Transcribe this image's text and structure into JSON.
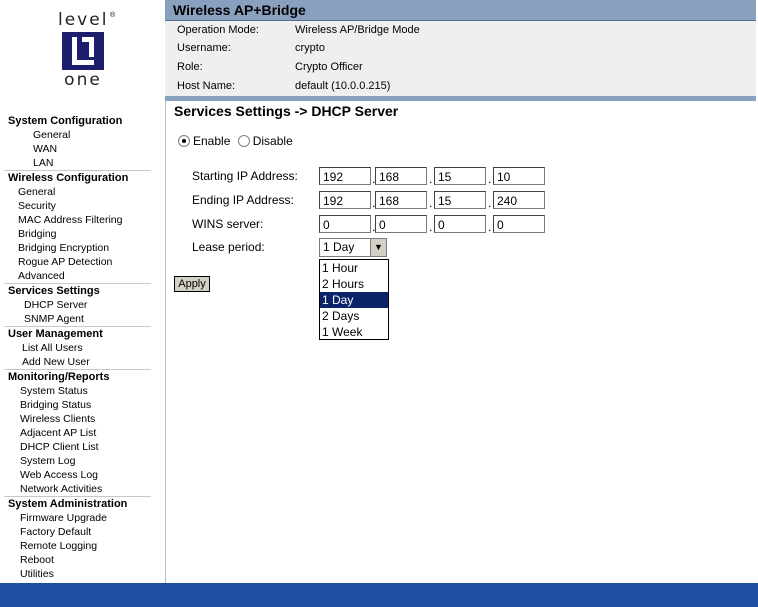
{
  "logo": {
    "top": "level",
    "bottom": "one",
    "reg": "®"
  },
  "header": {
    "title": "Wireless AP+Bridge",
    "info": [
      {
        "label": "Operation Mode:",
        "value": "Wireless AP/Bridge Mode"
      },
      {
        "label": "Username:",
        "value": "crypto"
      },
      {
        "label": "Role:",
        "value": "Crypto Officer"
      },
      {
        "label": "Host Name:",
        "value": "default (10.0.0.215)"
      }
    ]
  },
  "sidebar": {
    "sections": [
      {
        "title": "System Configuration",
        "items": [
          "General",
          "WAN",
          "LAN"
        ]
      },
      {
        "title": "Wireless Configuration",
        "items": [
          "General",
          "Security",
          "MAC Address Filtering",
          "Bridging",
          "Bridging Encryption",
          "Rogue AP Detection",
          "Advanced"
        ]
      },
      {
        "title": "Services Settings",
        "items": [
          "DHCP Server",
          "SNMP Agent"
        ]
      },
      {
        "title": "User Management",
        "items": [
          "List All Users",
          "Add New User"
        ]
      },
      {
        "title": "Monitoring/Reports",
        "items": [
          "System Status",
          "Bridging Status",
          "Wireless Clients",
          "Adjacent AP List",
          "DHCP Client List",
          "System Log",
          "Web Access Log",
          "Network Activities"
        ]
      },
      {
        "title": "System Administration",
        "items": [
          "Firmware Upgrade",
          "Factory Default",
          "Remote Logging",
          "Reboot",
          "Utilities"
        ]
      }
    ]
  },
  "main": {
    "title": "Services Settings -> DHCP Server",
    "enable_label": "Enable",
    "disable_label": "Disable",
    "starting_ip": {
      "label": "Starting IP Address:",
      "octets": [
        "192",
        "168",
        "15",
        "10"
      ]
    },
    "ending_ip": {
      "label": "Ending IP Address:",
      "octets": [
        "192",
        "168",
        "15",
        "240"
      ]
    },
    "wins": {
      "label": "WINS server:",
      "octets": [
        "0",
        "0",
        "0",
        "0"
      ]
    },
    "lease": {
      "label": "Lease period:",
      "selected": "1 Day",
      "options": [
        "1 Hour",
        "2 Hours",
        "1 Day",
        "2 Days",
        "1 Week"
      ]
    },
    "apply_label": "Apply",
    "dot": "."
  },
  "colors": {
    "header": "#8aa0bf",
    "footer": "#1d4ea1",
    "selected": "#0a246a",
    "logo": "#1c1f6e"
  }
}
